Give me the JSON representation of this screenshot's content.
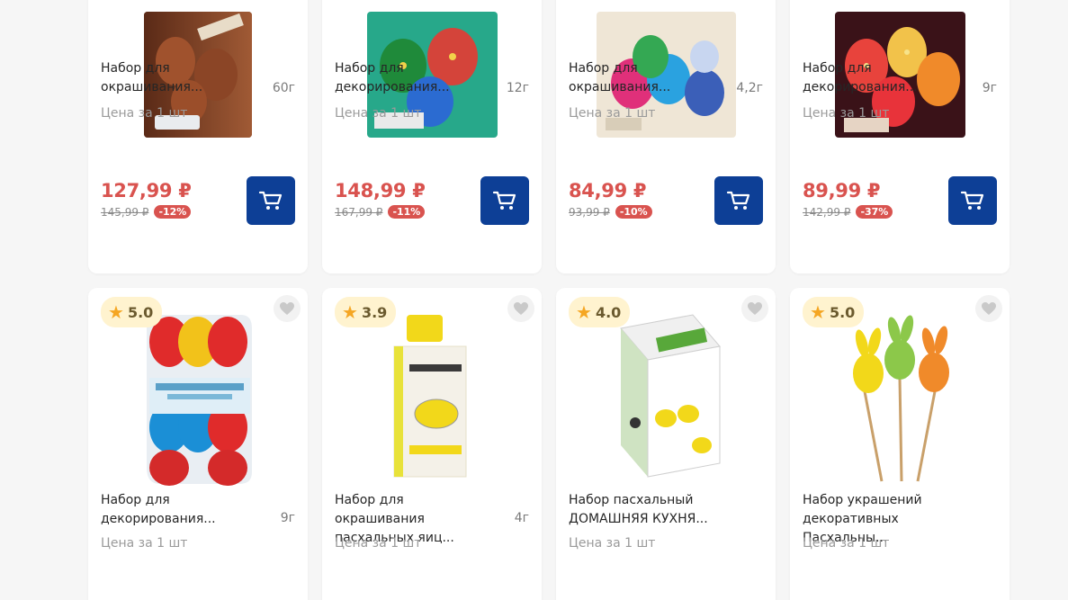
{
  "products_row1": [
    {
      "title": "Набор для окрашивания...",
      "weight": "60г",
      "unit_price_label": "Цена за 1 шт",
      "price": "127,99 ₽",
      "old_price": "145,99 ₽",
      "discount": "-12%",
      "image": "egg-dye-kit-brown-box",
      "cart_icon": "cart-icon"
    },
    {
      "title": "Набор для декорирования...",
      "weight": "12г",
      "unit_price_label": "Цена за 1 шт",
      "price": "148,99 ₽",
      "old_price": "167,99 ₽",
      "discount": "-11%",
      "image": "egg-decor-kit-green",
      "cart_icon": "cart-icon"
    },
    {
      "title": "Набор для окрашивания...",
      "weight": "4,2г",
      "unit_price_label": "Цена за 1 шт",
      "price": "84,99 ₽",
      "old_price": "93,99 ₽",
      "discount": "-10%",
      "image": "egg-dye-kit-colorful",
      "cart_icon": "cart-icon"
    },
    {
      "title": "Набор для декорирования...",
      "weight": "9г",
      "unit_price_label": "Цена за 1 шт",
      "price": "89,99 ₽",
      "old_price": "142,99 ₽",
      "discount": "-37%",
      "image": "egg-decor-kit-dark",
      "cart_icon": "cart-icon"
    }
  ],
  "products_row2": [
    {
      "rating": "5.0",
      "title": "Набор для декорирования...",
      "weight": "9г",
      "unit_price_label": "Цена за 1 шт",
      "image": "pearl-dyes-pack",
      "fav_icon": "heart-icon"
    },
    {
      "rating": "3.9",
      "title": "Набор для окрашивания пасхальных яиц...",
      "weight": "4г",
      "unit_price_label": "Цена за 1 шт",
      "image": "egg-holder-box",
      "fav_icon": "heart-icon"
    },
    {
      "rating": "4.0",
      "title": "Набор пасхальный ДОМАШНЯЯ КУХНЯ...",
      "weight": "",
      "unit_price_label": "Цена за 1 шт",
      "image": "wheat-grass-box",
      "fav_icon": "heart-icon"
    },
    {
      "rating": "5.0",
      "title": "Набор украшений декоративных Пасхальны...",
      "weight": "",
      "unit_price_label": "Цена за 1 шт",
      "image": "easter-bunny-picks",
      "fav_icon": "heart-icon"
    }
  ],
  "colors": {
    "price": "#d9534f",
    "cart_button": "#0d3f96",
    "rating_bg": "#fff3cf",
    "star": "#f5a623"
  }
}
